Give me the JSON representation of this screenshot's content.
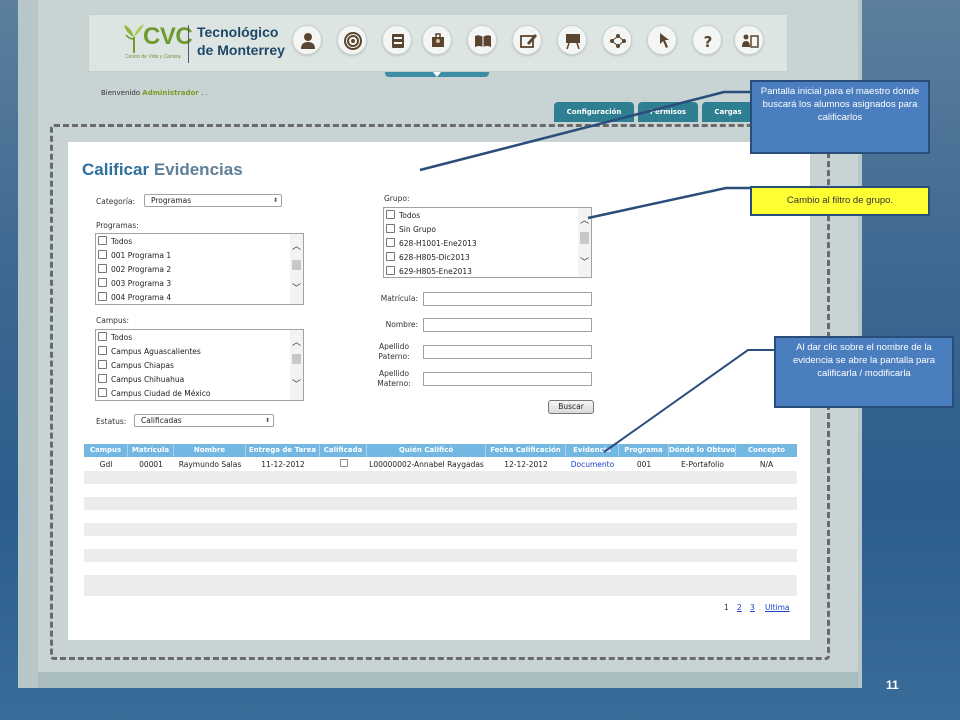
{
  "logo": {
    "brand": "CVC",
    "tagline": "Centro de Vida y Carrera",
    "line1": "Tecnológico",
    "line2": "de Monterrey"
  },
  "nav_icons": [
    "user-icon",
    "target-icon",
    "book-stack-icon",
    "briefcase-icon",
    "open-book-icon",
    "edit-icon",
    "presentation-icon",
    "network-icon",
    "click-icon",
    "help-icon",
    "people-icon"
  ],
  "welcome": {
    "prefix": "Bienvenido",
    "user": "Administrador",
    "suffix": ". ."
  },
  "tabs": [
    {
      "label": "Configuración"
    },
    {
      "label": "Permisos"
    },
    {
      "label": "Cargas"
    }
  ],
  "title": {
    "part1": "Calificar",
    "part2": "Evidencias"
  },
  "filters": {
    "categoria_label": "Categoría:",
    "categoria_value": "Programas",
    "programas_label": "Programas:",
    "programas": [
      "Todos",
      "001 Programa 1",
      "002 Programa 2",
      "003 Programa 3",
      "004 Programa 4"
    ],
    "campus_label": "Campus:",
    "campus": [
      "Todos",
      "Campus Aguascalientes",
      "Campus Chiapas",
      "Campus Chihuahua",
      "Campus Ciudad de México"
    ],
    "estatus_label": "Estatus:",
    "estatus_value": "Calificadas",
    "grupo_label": "Grupo:",
    "grupos": [
      "Todos",
      "Sin Grupo",
      "628-H1001-Ene2013",
      "628-H805-Dic2013",
      "629-H805-Ene2013"
    ],
    "matricula_label": "Matrícula:",
    "nombre_label": "Nombre:",
    "ap_paterno_label1": "Apellido",
    "ap_paterno_label2": "Paterno:",
    "ap_materno_label1": "Apellido",
    "ap_materno_label2": "Materno:",
    "search_button": "Buscar"
  },
  "table": {
    "headers": [
      "Campus",
      "Matrícula",
      "Nombre",
      "Entrega de Tarea",
      "Calificada",
      "Quién Calificó",
      "Fecha Calificación",
      "Evidencia",
      "Programa",
      "Dónde lo Obtuvo",
      "Concepto"
    ],
    "rows": [
      {
        "campus": "Gdl",
        "matricula": "00001",
        "nombre": "Raymundo Salas",
        "entrega": "11-12-2012",
        "calificada": false,
        "quien": "L00000002-Annabel Raygadas",
        "fecha": "12-12-2012",
        "evidencia": "Documento",
        "programa": "001",
        "donde": "E-Portafolio",
        "concepto": "N/A"
      }
    ],
    "pager": [
      "1",
      "2",
      "3",
      "Ultima"
    ]
  },
  "callouts": {
    "c1": "Pantalla inicial para el maestro donde buscará los alumnos asignados para calificarlos",
    "c2": "Cambio al filtro de grupo.",
    "c3": "Al dar clic sobre el nombre de la evidencia se abre la pantalla para calificarla / modificarla"
  },
  "slide_number": "11",
  "colors": {
    "accent_teal": "#2f7f93",
    "table_header": "#73b7e3",
    "callout_blue": "#4a7ebf",
    "callout_yellow": "#ffff33",
    "title_blue": "#2e6f9e",
    "brand_green": "#6f9b2f"
  }
}
